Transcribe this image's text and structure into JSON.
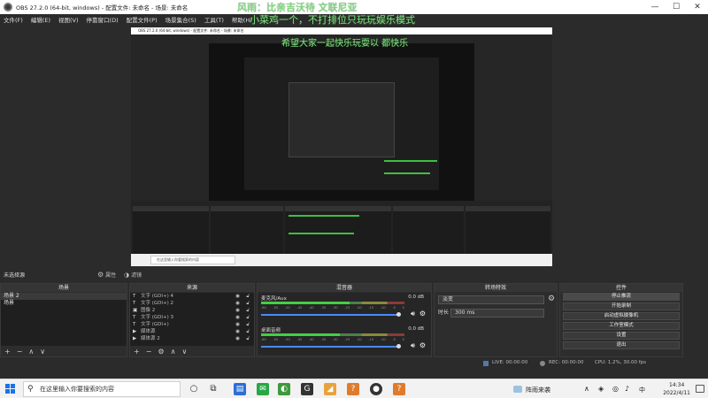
{
  "window": {
    "title": "OBS 27.2.0 (64-bit, windows) - 配置文件: 未命名 - 场景: 未命名",
    "minimize": "—",
    "maximize": "☐",
    "close": "✕"
  },
  "menu": [
    "文件(F)",
    "编辑(E)",
    "视图(V)",
    "停靠窗口(D)",
    "配置文件(P)",
    "场景集合(S)",
    "工具(T)",
    "帮助(H)"
  ],
  "danmaku": [
    "风雨：比亲吉沃待  文联尼亚",
    "小菜鸡一个，不打排位只玩玩娱乐模式",
    "希望大家一起快乐玩耍以   都快乐"
  ],
  "nested": {
    "title": "OBS 27.2.0 (64-bit, windows) - 配置文件: 未命名 - 场景: 未命名",
    "search_placeholder": "在这里输入你要搜索的内容",
    "no_source": "未选择源"
  },
  "dock_strip": {
    "no_source": "未选择源",
    "properties": "属性",
    "filters": "滤镜"
  },
  "scenes": {
    "header": "场景",
    "items": [
      "场景 2",
      "场景"
    ],
    "footer": [
      "+",
      "−",
      "∧",
      "∨"
    ]
  },
  "sources": {
    "header": "来源",
    "items": [
      {
        "icon": "T",
        "label": "文字 (GDI+) 4"
      },
      {
        "icon": "T",
        "label": "文字 (GDI+) 2"
      },
      {
        "icon": "▣",
        "label": "图像 2"
      },
      {
        "icon": "T",
        "label": "文字 (GDI+) 3"
      },
      {
        "icon": "T",
        "label": "文字 (GDI+)"
      },
      {
        "icon": "▶",
        "label": "媒体源"
      },
      {
        "icon": "▶",
        "label": "媒体源 2"
      }
    ],
    "footer": [
      "+",
      "−",
      "⚙",
      "∧",
      "∨"
    ]
  },
  "mixer": {
    "header": "混音器",
    "tracks": [
      {
        "name": "麦克风/Aux",
        "db": "0.0 dB",
        "level": 0.62
      },
      {
        "name": "桌面音频",
        "db": "0.0 dB",
        "level": 0.55
      }
    ],
    "scale": [
      "-60",
      "-55",
      "-50",
      "-45",
      "-40",
      "-35",
      "-30",
      "-25",
      "-20",
      "-15",
      "-10",
      "-5",
      "0"
    ]
  },
  "transitions": {
    "header": "转场特效",
    "selected": "淡变",
    "duration_label": "时长",
    "duration_value": "300 ms"
  },
  "controls": {
    "header": "控件",
    "buttons": [
      "停止推流",
      "开始录制",
      "启动虚拟摄像机",
      "工作室模式",
      "设置",
      "退出"
    ]
  },
  "status": {
    "live": "LIVE: 00:00:00",
    "rec": "REC: 00:00:00",
    "cpu": "CPU: 1.2%, 30.00 fps"
  },
  "taskbar": {
    "search_placeholder": "在这里输入你要搜索的内容",
    "tray_text": "阵雨来袭",
    "lang": "中",
    "time": "14:34",
    "date": "2022/4/11",
    "colors": {
      "accent": "#1a73e8",
      "green": "#41d141"
    }
  }
}
